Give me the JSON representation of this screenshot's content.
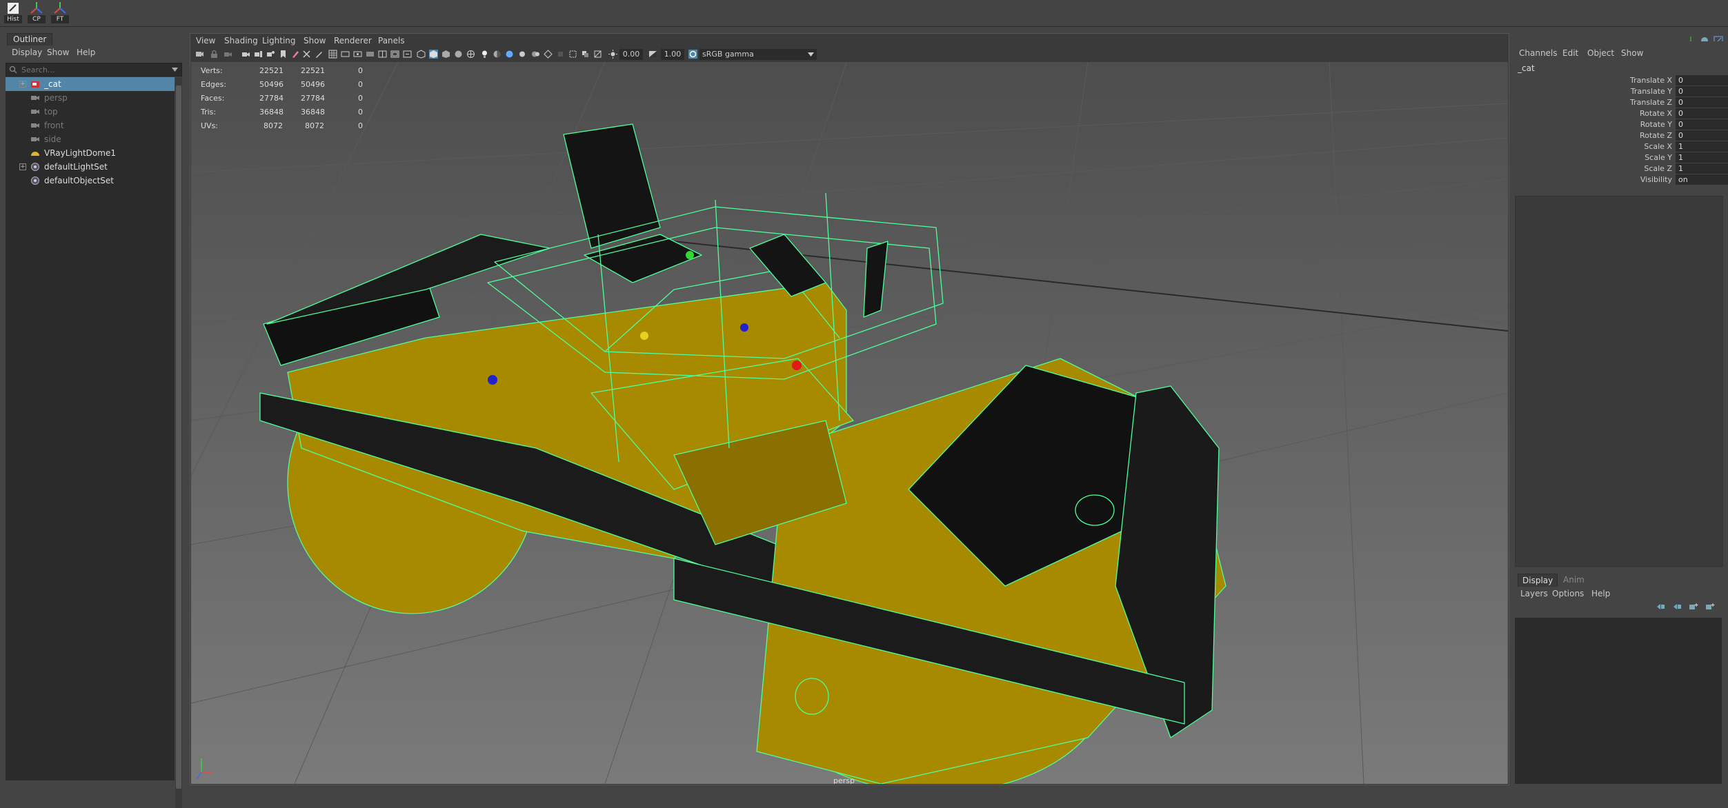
{
  "shelf": {
    "buttons": [
      {
        "label": "Hist",
        "icon": "history-icon"
      },
      {
        "label": "CP",
        "icon": "center-pivot-icon"
      },
      {
        "label": "FT",
        "icon": "freeze-transform-icon"
      }
    ]
  },
  "outliner": {
    "tab_label": "Outliner",
    "menu": [
      "Display",
      "Show",
      "Help"
    ],
    "search_placeholder": "Search...",
    "items": [
      {
        "label": "_cat",
        "icon": "mesh-icon",
        "selected": true,
        "dim": false
      },
      {
        "label": "persp",
        "icon": "camera-icon",
        "selected": false,
        "dim": true
      },
      {
        "label": "top",
        "icon": "camera-icon",
        "selected": false,
        "dim": true
      },
      {
        "label": "front",
        "icon": "camera-icon",
        "selected": false,
        "dim": true
      },
      {
        "label": "side",
        "icon": "camera-icon",
        "selected": false,
        "dim": true
      },
      {
        "label": "VRayLightDome1",
        "icon": "dome-light-icon",
        "selected": false,
        "dim": false
      },
      {
        "label": "defaultLightSet",
        "icon": "set-icon",
        "selected": false,
        "dim": false
      },
      {
        "label": "defaultObjectSet",
        "icon": "set-icon",
        "selected": false,
        "dim": false
      }
    ]
  },
  "viewport": {
    "menu": [
      "View",
      "Shading",
      "Lighting",
      "Show",
      "Renderer",
      "Panels"
    ],
    "exposure": "0.00",
    "gamma": "1.00",
    "color_space": "sRGB gamma",
    "camera": "persp",
    "hud": [
      {
        "label": "Verts:",
        "a": "22521",
        "b": "22521",
        "c": "0"
      },
      {
        "label": "Edges:",
        "a": "50496",
        "b": "50496",
        "c": "0"
      },
      {
        "label": "Faces:",
        "a": "27784",
        "b": "27784",
        "c": "0"
      },
      {
        "label": "Tris:",
        "a": "36848",
        "b": "36848",
        "c": "0"
      },
      {
        "label": "UVs:",
        "a": "8072",
        "b": "8072",
        "c": "0"
      }
    ]
  },
  "channel_box": {
    "menu": [
      "Channels",
      "Edit",
      "Object",
      "Show"
    ],
    "object": "_cat",
    "attributes": [
      {
        "name": "Translate X",
        "value": "0"
      },
      {
        "name": "Translate Y",
        "value": "0"
      },
      {
        "name": "Translate Z",
        "value": "0"
      },
      {
        "name": "Rotate X",
        "value": "0"
      },
      {
        "name": "Rotate Y",
        "value": "0"
      },
      {
        "name": "Rotate Z",
        "value": "0"
      },
      {
        "name": "Scale X",
        "value": "1"
      },
      {
        "name": "Scale Y",
        "value": "1"
      },
      {
        "name": "Scale Z",
        "value": "1"
      },
      {
        "name": "Visibility",
        "value": "on"
      }
    ]
  },
  "layer_editor": {
    "tabs": [
      "Display",
      "Anim"
    ],
    "menu": [
      "Layers",
      "Options",
      "Help"
    ]
  },
  "colors": {
    "selection": "#5285a6",
    "wireframe": "#4dff9a",
    "body_yellow": "#a88a00",
    "background": "#444444"
  }
}
